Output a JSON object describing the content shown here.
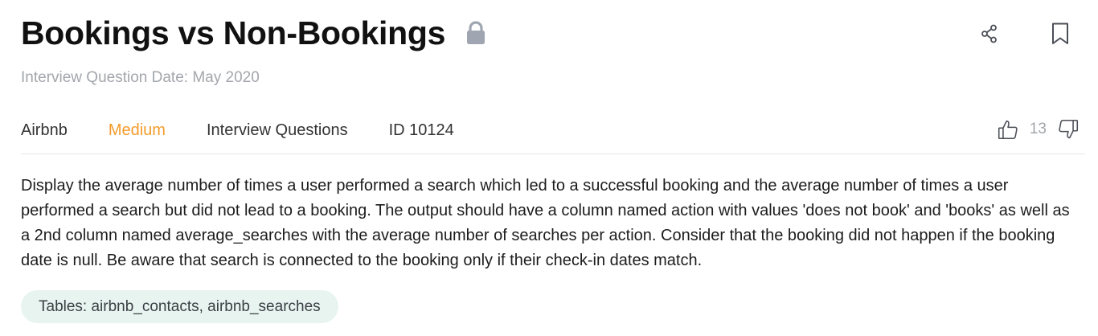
{
  "question": {
    "title": "Bookings vs Non-Bookings",
    "date_label": "Interview Question Date: May 2020",
    "company": "Airbnb",
    "difficulty": "Medium",
    "category": "Interview Questions",
    "id_label": "ID 10124",
    "votes": "13",
    "description": "Display the average number of times a user performed a search which led to a successful booking and the average number of times a user performed a search but did not lead to a booking. The output should have a column named action with values 'does not book' and 'books' as well as a 2nd column named average_searches with the average number of searches per action. Consider that the booking did not happen if the booking date is null. Be aware that search is connected to the booking only if their check-in dates match.",
    "tables_label": "Tables: airbnb_contacts, airbnb_searches"
  },
  "icons": {
    "lock": "lock-icon",
    "share": "share-icon",
    "bookmark": "bookmark-icon",
    "thumbs_up": "thumbs-up-icon",
    "thumbs_down": "thumbs-down-icon"
  },
  "colors": {
    "difficulty_medium": "#f39c2c",
    "muted": "#a3a6ab",
    "tables_badge_bg": "#e8f4f0"
  }
}
